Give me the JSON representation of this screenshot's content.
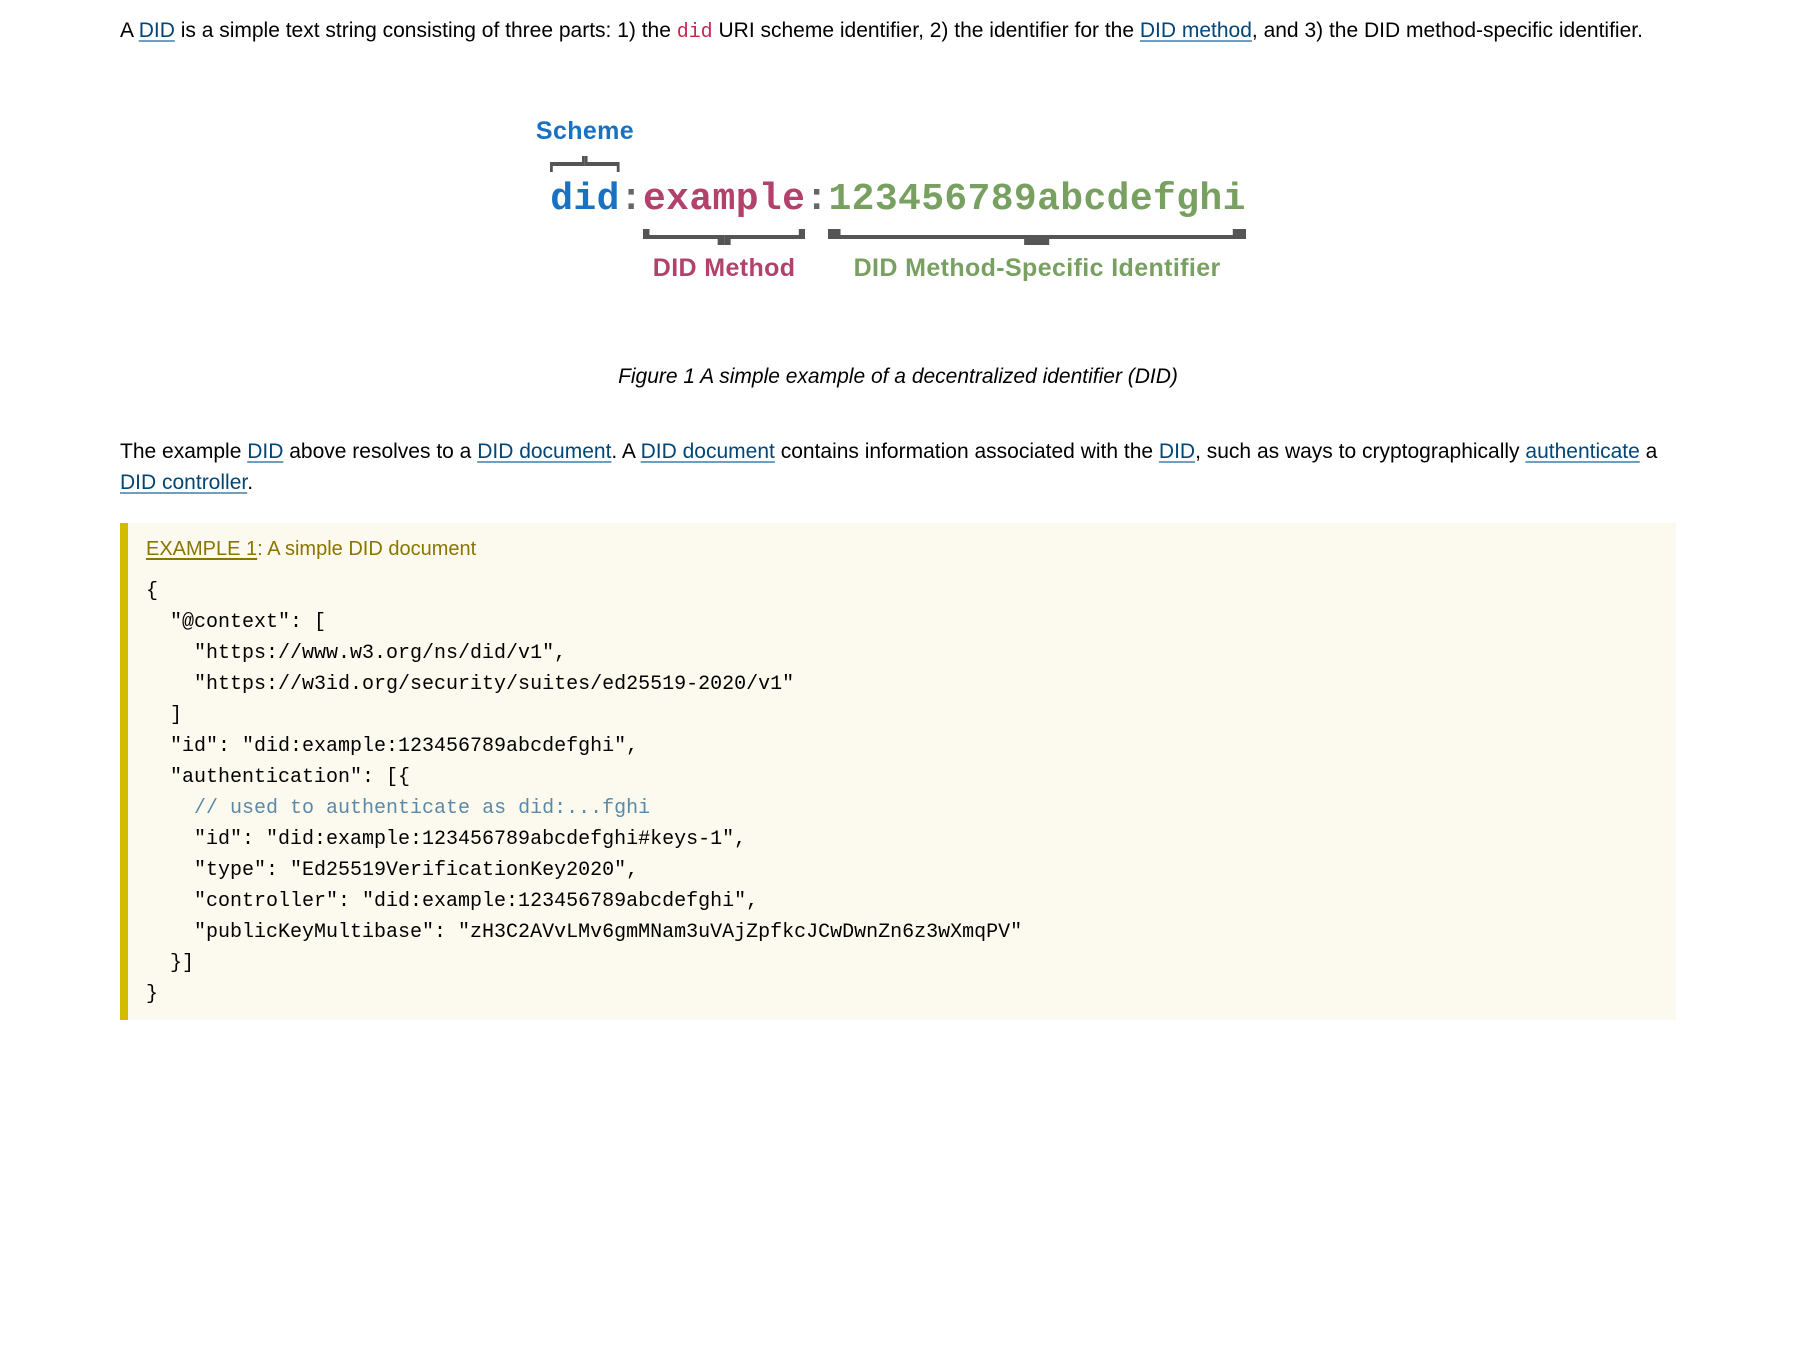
{
  "para1": {
    "t1": "A ",
    "link_did": "DID",
    "t2": " is a simple text string consisting of three parts: 1) the ",
    "code_did": "did",
    "t3": " URI scheme identifier, 2) the identifier for the ",
    "link_method": "DID method",
    "t4": ", and 3) the DID method-specific identifier."
  },
  "diagram": {
    "scheme": "did",
    "colon": ":",
    "method": "example",
    "msi": "123456789abcdefghi",
    "label_scheme": "Scheme",
    "label_method": "DID Method",
    "label_msi": "DID Method-Specific Identifier"
  },
  "figcaption_lead": "Figure 1",
  "figcaption_text": " A simple example of a decentralized identifier (DID)",
  "para2": {
    "t1": "The example ",
    "link_did": "DID",
    "t2": " above resolves to a ",
    "link_doc1": "DID document",
    "t3": ". A ",
    "link_doc2": "DID document",
    "t4": " contains information associated with the ",
    "link_did2": "DID",
    "t5": ", such as ways to cryptographically ",
    "link_auth": "authenticate",
    "t6": " a ",
    "link_ctrl": "DID controller",
    "t7": "."
  },
  "example": {
    "marker": "EXAMPLE 1",
    "name": "A simple DID document",
    "code_before_comment": "{\n  \"@context\": [\n    \"https://www.w3.org/ns/did/v1\",\n    \"https://w3id.org/security/suites/ed25519-2020/v1\"\n  ]\n  \"id\": \"did:example:123456789abcdefghi\",\n  \"authentication\": [{\n    ",
    "comment": "// used to authenticate as did:...fghi",
    "code_after_comment": "\n    \"id\": \"did:example:123456789abcdefghi#keys-1\",\n    \"type\": \"Ed25519VerificationKey2020\",\n    \"controller\": \"did:example:123456789abcdefghi\",\n    \"publicKeyMultibase\": \"zH3C2AVvLMv6gmMNam3uVAjZpfkcJCwDwnZn6z3wXmqPV\"\n  }]\n}"
  }
}
